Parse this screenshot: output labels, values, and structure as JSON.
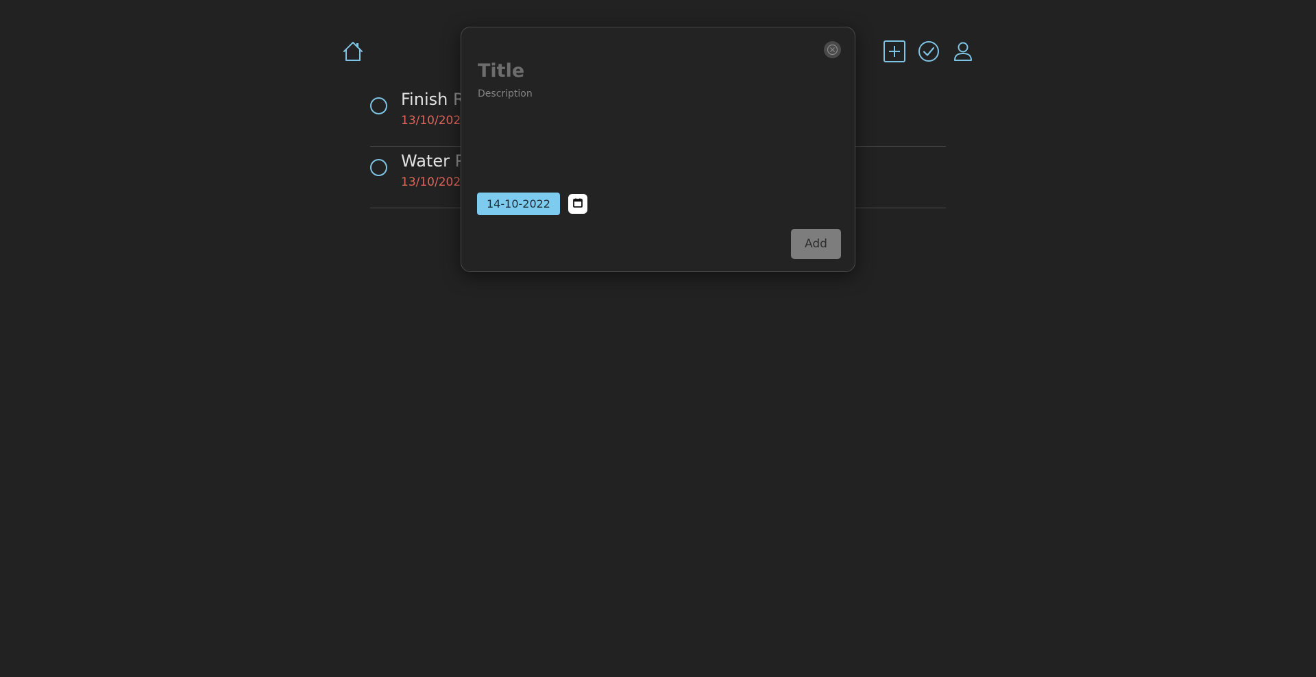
{
  "header": {
    "home_icon": "home-icon",
    "add_icon": "plus-square-icon",
    "done_icon": "check-circle-icon",
    "user_icon": "user-icon",
    "accent_color": "#7ec4e4"
  },
  "tasks": [
    {
      "title_visible": "Finish ",
      "title_partial": "R",
      "date": "13/10/202"
    },
    {
      "title_visible": "Water ",
      "title_partial": "P",
      "date": "13/10/202"
    }
  ],
  "modal": {
    "title_placeholder": "Title",
    "title_value": "",
    "description_placeholder": "Description",
    "description_value": "",
    "date_value": "14-10-2022",
    "date_color": "#7ecbf0",
    "calendar_icon": "calendar-icon",
    "close_icon": "close-icon",
    "add_label": "Add"
  },
  "colors": {
    "background": "#222222",
    "overdue_date": "#e0655a"
  }
}
